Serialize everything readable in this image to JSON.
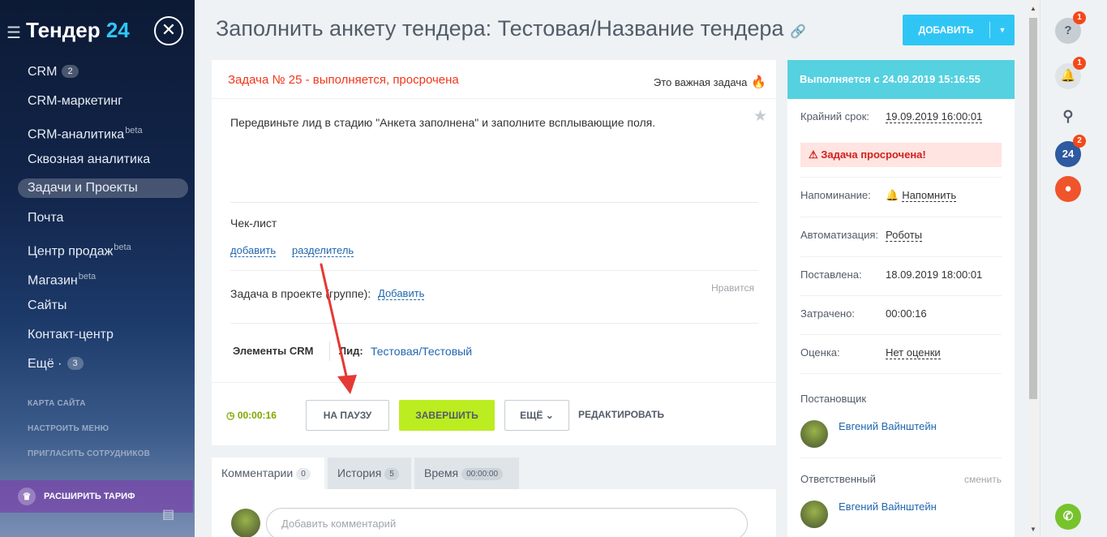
{
  "sidebar": {
    "brand_name": "Тендер",
    "brand_num": "24",
    "items": [
      {
        "label": "CRM",
        "badge": "2"
      },
      {
        "label": "CRM-маркетинг"
      },
      {
        "label": "CRM-аналитика",
        "sup": "beta"
      },
      {
        "label": "Сквозная аналитика"
      },
      {
        "label": "Задачи и Проекты",
        "active": true
      },
      {
        "label": "Почта"
      },
      {
        "label": "Центр продаж",
        "sup": "beta"
      },
      {
        "label": "Магазин",
        "sup": "beta"
      },
      {
        "label": "Сайты"
      },
      {
        "label": "Контакт-центр"
      },
      {
        "label": "Ещё ·",
        "badge": "3"
      }
    ],
    "links": [
      "КАРТА САЙТА",
      "НАСТРОИТЬ МЕНЮ",
      "ПРИГЛАСИТЬ СОТРУДНИКОВ"
    ],
    "upgrade": "РАСШИРИТЬ ТАРИФ"
  },
  "header": {
    "title": "Заполнить анкету тендера: Тестовая/Название тендера",
    "add_button": "ДОБАВИТЬ"
  },
  "task": {
    "status": "Задача № 25 - выполняется, просрочена",
    "important": "Это важная задача",
    "description": "Передвиньте лид в стадию \"Анкета заполнена\" и заполните всплывающие поля.",
    "checklist_title": "Чек-лист",
    "checklist_add": "добавить",
    "checklist_separator": "разделитель",
    "project_label": "Задача в проекте (группе):",
    "project_add": "Добавить",
    "likes": "Нравится",
    "crm_title": "Элементы CRM",
    "lead_label": "Лид:",
    "lead_value": "Тестовая/Тестовый",
    "timer": "00:00:16",
    "pause_button": "НА ПАУЗУ",
    "finish_button": "ЗАВЕРШИТЬ",
    "more_button": "ЕЩЁ",
    "edit_button": "РЕДАКТИРОВАТЬ"
  },
  "tabs": [
    {
      "label": "Комментарии",
      "count": "0"
    },
    {
      "label": "История",
      "count": "5"
    },
    {
      "label": "Время",
      "count": "00:00:00"
    }
  ],
  "comment": {
    "placeholder": "Добавить комментарий"
  },
  "right_panel": {
    "header": "Выполняется с 24.09.2019 15:16:55",
    "deadline_label": "Крайний срок:",
    "deadline_value": "19.09.2019 16:00:01",
    "overdue": "Задача просрочена!",
    "reminder_label": "Напоминание:",
    "reminder_value": "Напомнить",
    "automation_label": "Автоматизация:",
    "automation_value": "Роботы",
    "created_label": "Поставлена:",
    "created_value": "18.09.2019 18:00:01",
    "spent_label": "Затрачено:",
    "spent_value": "00:00:16",
    "rating_label": "Оценка:",
    "rating_value": "Нет оценки",
    "creator_title": "Постановщик",
    "creator_name": "Евгений Вайнштейн",
    "responsible_title": "Ответственный",
    "responsible_change": "сменить",
    "responsible_name": "Евгений Вайнштейн"
  },
  "right_column": {
    "help_count": "1",
    "bell_count": "1",
    "b24_label": "24",
    "b24_count": "2"
  },
  "colors": {
    "accent": "#2fc6f6",
    "finish_green": "#bbed21",
    "overdue_red": "#f1361b",
    "panel_header": "#56d1e0",
    "annotation_red": "#e53935"
  }
}
